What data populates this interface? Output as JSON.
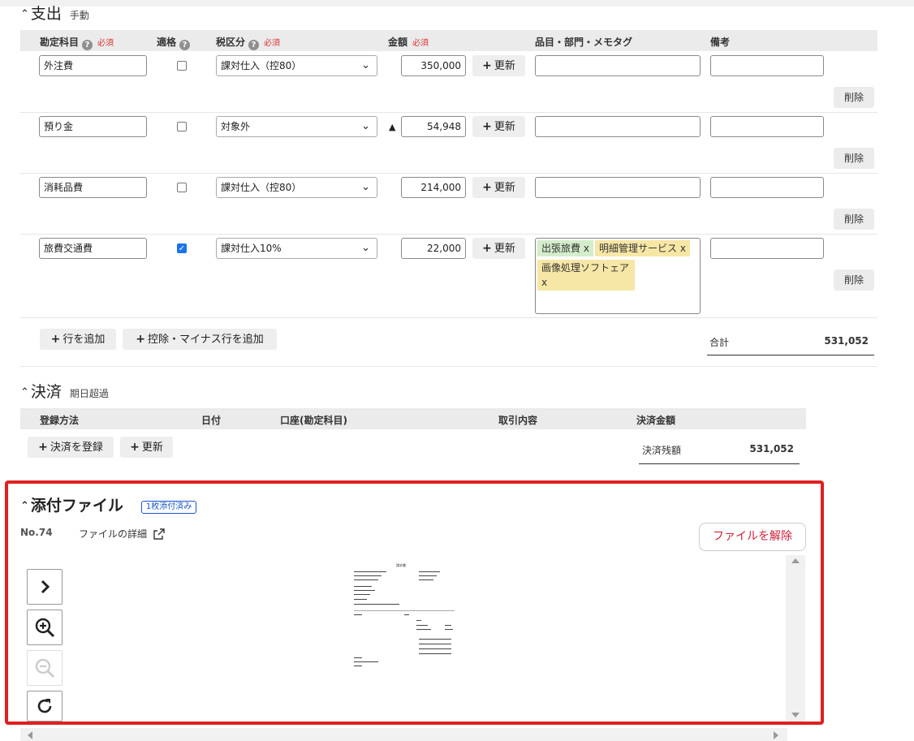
{
  "expense": {
    "title": "支出",
    "mode": "手動",
    "headers": {
      "account": "勘定科目",
      "eligible": "適格",
      "tax": "税区分",
      "amount": "金額",
      "tags": "品目・部門・メモタグ",
      "notes": "備考",
      "required": "必須",
      "help": "?"
    },
    "rows": [
      {
        "account": "外注費",
        "eligible": false,
        "tax": "課対仕入（控80）",
        "amount": "350,000",
        "deduction": false,
        "tags": [],
        "note": ""
      },
      {
        "account": "預り金",
        "eligible": false,
        "tax": "対象外",
        "amount": "54,948",
        "deduction": true,
        "tags": [],
        "note": ""
      },
      {
        "account": "消耗品費",
        "eligible": false,
        "tax": "課対仕入（控80）",
        "amount": "214,000",
        "deduction": false,
        "tags": [],
        "note": ""
      },
      {
        "account": "旅費交通費",
        "eligible": true,
        "tax": "課対仕入10%",
        "amount": "22,000",
        "deduction": false,
        "tags": [
          "出張旅費 x",
          "明細管理サービス x",
          "画像処理ソフトェア"
        ],
        "tag_x": "x",
        "note": ""
      }
    ],
    "deduction_marker": "▲",
    "update_label": "更新",
    "delete_label": "削除",
    "add_row_label": "行を追加",
    "add_deduction_label": "控除・マイナス行を追加",
    "total_label": "合計",
    "total_value": "531,052"
  },
  "settlement": {
    "title": "決済",
    "status": "期日超過",
    "headers": {
      "method": "登録方法",
      "date": "日付",
      "account": "口座(勘定科目)",
      "detail": "取引内容",
      "amount": "決済金額"
    },
    "register_label": "決済を登録",
    "update_label": "更新",
    "balance_label": "決済残額",
    "balance_value": "531,052"
  },
  "attachment": {
    "title": "添付ファイル",
    "badge": "1枚添付済み",
    "file_no": "No.74",
    "details_link": "ファイルの詳細",
    "remove_label": "ファイルを解除",
    "doc_title": "請求書"
  },
  "icons": {
    "caret": "chevron-up-icon",
    "plus": "plus-icon",
    "next": "chevron-right-icon",
    "zoom_in": "zoom-in-icon",
    "zoom_out": "zoom-out-icon",
    "rotate": "rotate-icon",
    "external": "external-link-icon"
  },
  "colors": {
    "required": "#dd3333",
    "highlight": "#e02020",
    "badge": "#1a56c8",
    "tag_green": "#d4edcc",
    "tag_yellow": "#f7e7a6",
    "remove_text": "#d0203a"
  }
}
